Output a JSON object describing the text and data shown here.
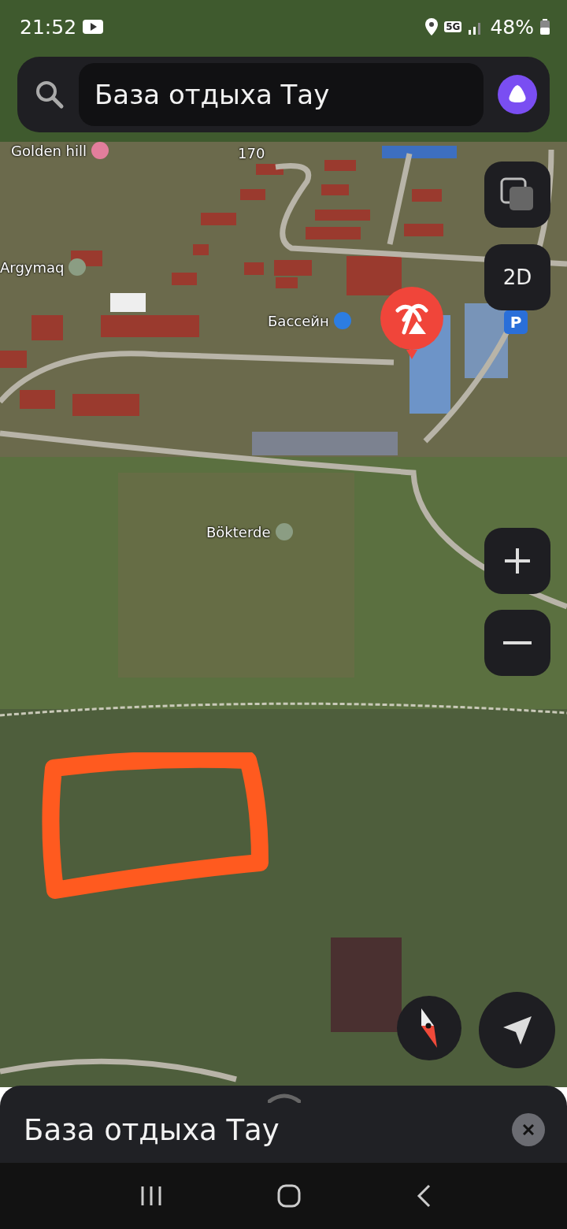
{
  "status_bar": {
    "time": "21:52",
    "network": "5G",
    "battery": "48%"
  },
  "search": {
    "value": "База отдыха Тау"
  },
  "map": {
    "labels": [
      {
        "text": "Golden hill",
        "kind": "lotus"
      },
      {
        "text": "170",
        "kind": "plain"
      },
      {
        "text": "Argymaq",
        "kind": "horse"
      },
      {
        "text": "Бассейн",
        "kind": "swim"
      },
      {
        "text": "P",
        "kind": "parking"
      },
      {
        "text": "Bökterde",
        "kind": "horse"
      }
    ]
  },
  "controls": {
    "view_mode": "2D"
  },
  "place_sheet": {
    "title": "База отдыха Тау"
  }
}
